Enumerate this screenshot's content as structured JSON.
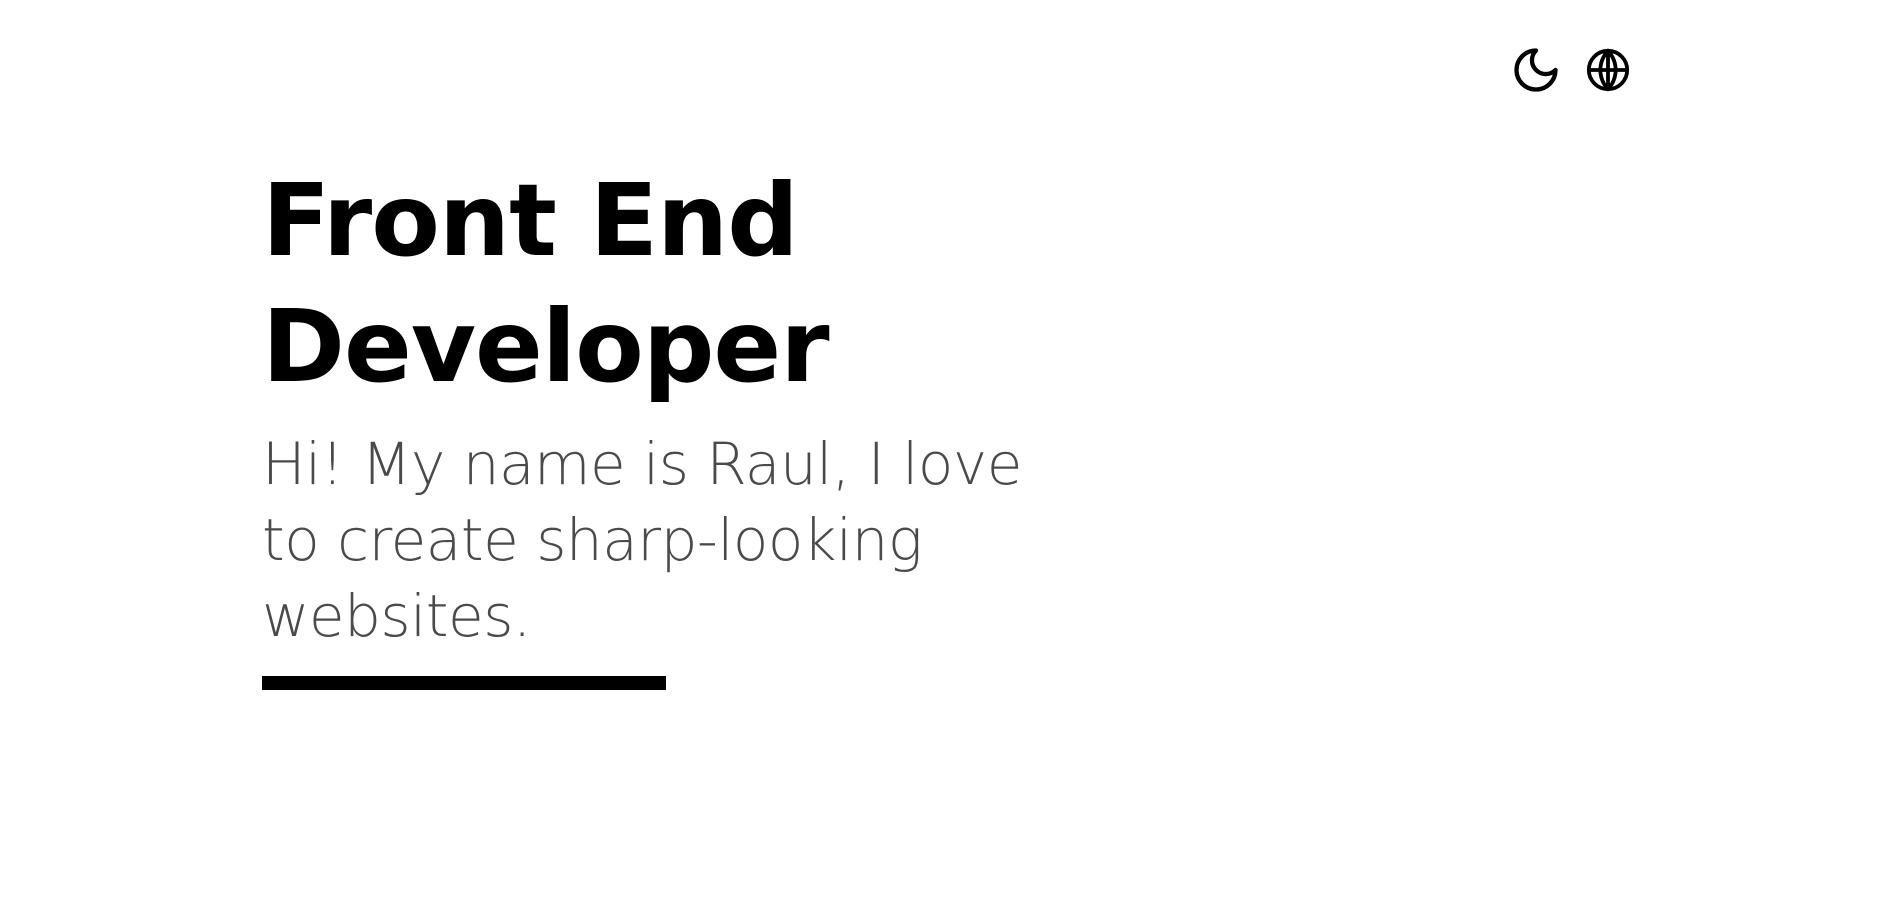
{
  "header": {
    "theme_toggle_icon": "moon-icon",
    "language_icon": "globe-icon"
  },
  "hero": {
    "title_line_1": "Front End",
    "title_line_2": "Developer",
    "intro": "Hi! My name is Raul, I love to create sharp-looking websites."
  },
  "colors": {
    "background": "#ffffff",
    "title": "#000000",
    "intro_text": "#4a4a4a",
    "accent_bar": "#000000"
  }
}
